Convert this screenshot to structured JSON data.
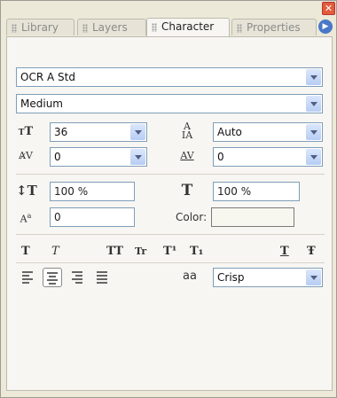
{
  "tabs": [
    {
      "label": "Library"
    },
    {
      "label": "Layers"
    },
    {
      "label": "Character"
    },
    {
      "label": "Properties"
    }
  ],
  "font": {
    "family": "OCR A Std",
    "style": "Medium"
  },
  "size": {
    "value": "36"
  },
  "leading": {
    "value": "Auto"
  },
  "kerning": {
    "value": "0"
  },
  "tracking": {
    "value": "0"
  },
  "vertical_scale": {
    "value": "100 %"
  },
  "horizontal_scale": {
    "value": "100 %"
  },
  "baseline_shift": {
    "value": "0"
  },
  "color": {
    "label": "Color:",
    "swatch": "#f7f6ef"
  },
  "styles": {
    "bold": "T",
    "italic": "T",
    "allcaps": "TT",
    "smallcaps": "Tr",
    "superscript": "T¹",
    "subscript": "T₁",
    "underline": "T",
    "strikethrough": "Ŧ"
  },
  "antialias": {
    "icon_label": "aa",
    "value": "Crisp"
  },
  "colors": {
    "accent": "#4a78c8",
    "close": "#e15c3b",
    "field_border": "#7f9db9"
  }
}
